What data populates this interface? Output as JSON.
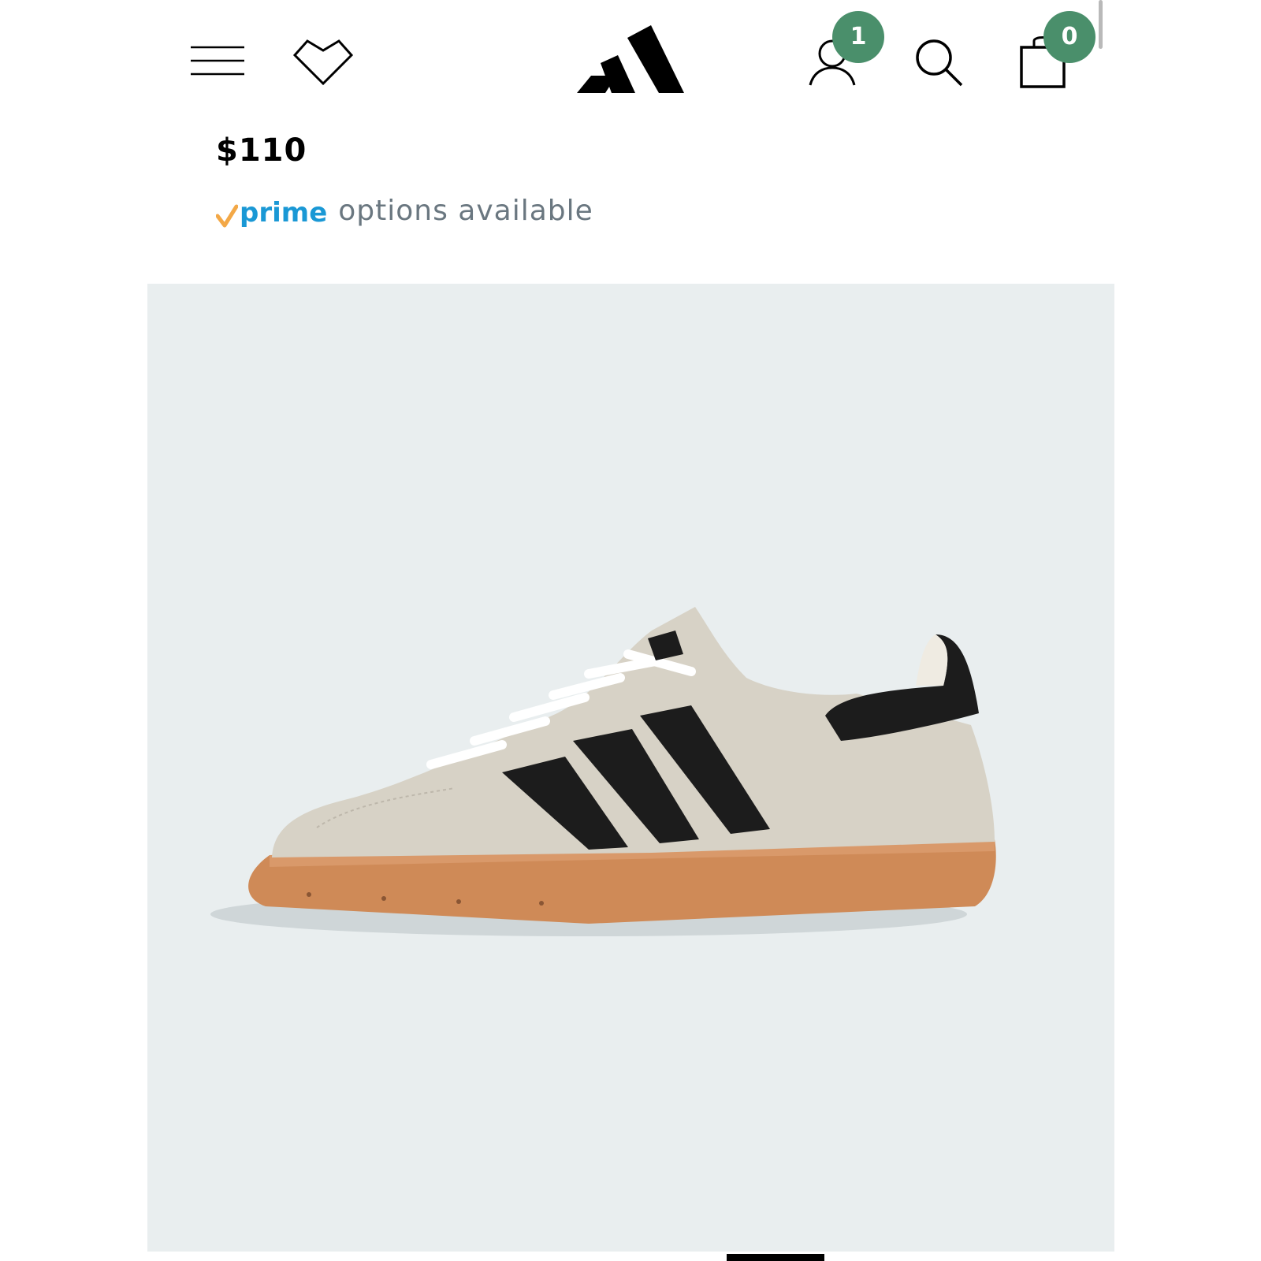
{
  "header": {
    "menu_icon": "hamburger-menu-icon",
    "wishlist_icon": "heart-icon",
    "logo": "adidas-logo",
    "account_icon": "user-icon",
    "account_badge": "1",
    "search_icon": "search-icon",
    "cart_icon": "shopping-bag-icon",
    "cart_badge": "0"
  },
  "product": {
    "price": "$110",
    "prime_label": "prime",
    "prime_text": "options available",
    "image_alt": "product-photo-sneaker"
  },
  "colors": {
    "badge": "#4a8f6b",
    "prime_check": "#f3a847",
    "prime_blue": "#1a98d5",
    "image_background": "#e9eeef",
    "suede": "#d7d2c6",
    "stripes": "#1c1c1c",
    "gum_sole": "#cf8a57"
  }
}
